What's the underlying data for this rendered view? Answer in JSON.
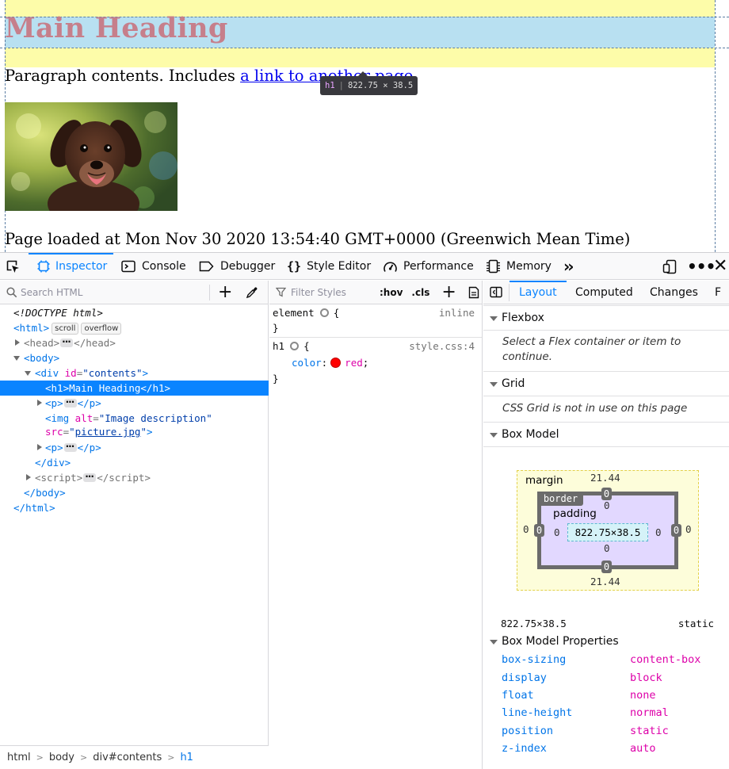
{
  "page": {
    "heading": "Main Heading",
    "paragraph_prefix": "Paragraph contents. Includes ",
    "link_text": "a link to another page",
    "paragraph_suffix": ".",
    "image_alt": "Image description",
    "loaded_text": "Page loaded at Mon Nov 30 2020 13:54:40 GMT+0000 (Greenwich Mean Time)"
  },
  "highlighter": {
    "tag": "h1",
    "dimensions": "822.75 × 38.5"
  },
  "toolbox": {
    "tools": [
      {
        "label": "Inspector",
        "icon": "inspector-icon",
        "selected": true
      },
      {
        "label": "Console",
        "icon": "console-icon"
      },
      {
        "label": "Debugger",
        "icon": "debugger-icon"
      },
      {
        "label": "Style Editor",
        "icon": "style-editor-icon"
      },
      {
        "label": "Performance",
        "icon": "performance-icon"
      },
      {
        "label": "Memory",
        "icon": "memory-icon"
      }
    ]
  },
  "markup": {
    "search_placeholder": "Search HTML",
    "lines": {
      "doctype": "<!DOCTYPE html>",
      "html_open": "html",
      "html_badges": [
        "scroll",
        "overflow"
      ],
      "head": "head",
      "body": "body",
      "div_tag": "div",
      "div_attr": "id",
      "div_val": "\"contents\"",
      "h1": "<h1>Main Heading</h1>",
      "p": "p",
      "img_tag": "img",
      "img_alt_attr": "alt",
      "img_alt_val": "\"Image description\"",
      "img_src_attr": "src",
      "img_src_val": "picture.jpg",
      "script": "script"
    },
    "breadcrumbs": [
      "html",
      "body",
      "div#contents",
      "h1"
    ]
  },
  "rules": {
    "filter_placeholder": "Filter Styles",
    "hov": ":hov",
    "cls": ".cls",
    "element_selector": "element",
    "element_source": "inline",
    "h1_selector": "h1",
    "h1_source": "style.css:4",
    "h1_property": "color",
    "h1_value": "red",
    "h1_swatch": "#ff0000"
  },
  "sidebar": {
    "tabs": [
      "Layout",
      "Computed",
      "Changes",
      "F"
    ],
    "selected_tab": "Layout",
    "flexbox": {
      "title": "Flexbox",
      "message": "Select a Flex container or item to continue."
    },
    "grid": {
      "title": "Grid",
      "message": "CSS Grid is not in use on this page"
    },
    "box_model": {
      "title": "Box Model",
      "margin_label": "margin",
      "border_label": "border",
      "padding_label": "padding",
      "margin_top": "21.44",
      "margin_bottom": "21.44",
      "margin_left": "0",
      "margin_right": "0",
      "border_top": "0",
      "border_bottom": "0",
      "border_left": "0",
      "border_right": "0",
      "padding_top": "0",
      "padding_bottom": "0",
      "padding_left": "0",
      "padding_right": "0",
      "content": "822.75×38.5",
      "size_readout": "822.75×38.5",
      "position_readout": "static"
    },
    "properties_title": "Box Model Properties",
    "properties": [
      {
        "name": "box-sizing",
        "value": "content-box"
      },
      {
        "name": "display",
        "value": "block"
      },
      {
        "name": "float",
        "value": "none"
      },
      {
        "name": "line-height",
        "value": "normal"
      },
      {
        "name": "position",
        "value": "static"
      },
      {
        "name": "z-index",
        "value": "auto"
      }
    ]
  },
  "colors": {
    "accent": "#0a84ff",
    "margin_highlight": "#fdfca9",
    "content_highlight": "#b8e0f1",
    "heading_on_highlight": "#c67f8b"
  }
}
